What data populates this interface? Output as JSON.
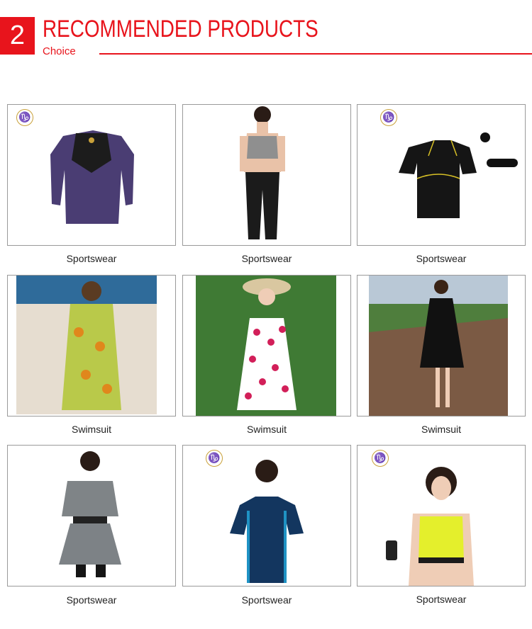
{
  "header": {
    "number": "2",
    "title": "RECOMMENDED PRODUCTS",
    "subtitle": "Choice",
    "accent_color": "#e8141c"
  },
  "products": [
    {
      "caption": "Sportswear",
      "kind": "long-sleeve-top-photo",
      "logo_icon": "brand-logo-icon"
    },
    {
      "caption": "Sportswear",
      "kind": "sports-bra-leggings-photo"
    },
    {
      "caption": "Sportswear",
      "kind": "short-sleeve-top-photo",
      "logo_icon": "brand-logo-icon"
    },
    {
      "caption": "Swimsuit",
      "kind": "floral-dress-beach-photo"
    },
    {
      "caption": "Swimsuit",
      "kind": "polka-dot-swimdress-photo"
    },
    {
      "caption": "Swimsuit",
      "kind": "black-swimdress-boardwalk-photo"
    },
    {
      "caption": "Sportswear",
      "kind": "grey-top-skirt-photo"
    },
    {
      "caption": "Sportswear",
      "kind": "blue-tshirt-photo",
      "logo_icon": "brand-logo-icon"
    },
    {
      "caption": "Sportswear",
      "kind": "yellow-sports-bra-photo",
      "logo_icon": "brand-logo-icon"
    }
  ],
  "logo_glyph": "♑"
}
